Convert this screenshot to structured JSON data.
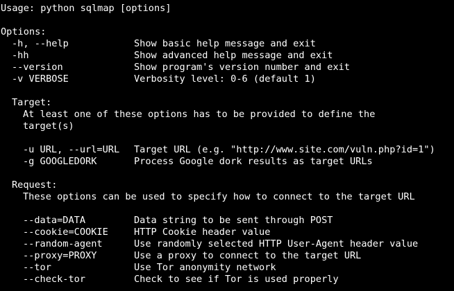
{
  "usage": "Usage: python sqlmap [options]",
  "options_header": "Options:",
  "options": [
    {
      "flag": "-h, --help",
      "desc": "Show basic help message and exit"
    },
    {
      "flag": "-hh",
      "desc": "Show advanced help message and exit"
    },
    {
      "flag": "--version",
      "desc": "Show program's version number and exit"
    },
    {
      "flag": "-v VERBOSE",
      "desc": "Verbosity level: 0-6 (default 1)"
    }
  ],
  "target": {
    "header": "Target:",
    "intro_line1": "At least one of these options has to be provided to define the",
    "intro_line2": "target(s)",
    "options": [
      {
        "flag": "-u URL, --url=URL",
        "desc": "Target URL (e.g. \"http://www.site.com/vuln.php?id=1\")"
      },
      {
        "flag": "-g GOOGLEDORK",
        "desc": "Process Google dork results as target URLs"
      }
    ]
  },
  "request": {
    "header": "Request:",
    "intro_line1": "These options can be used to specify how to connect to the target URL",
    "options": [
      {
        "flag": "--data=DATA",
        "desc": "Data string to be sent through POST"
      },
      {
        "flag": "--cookie=COOKIE",
        "desc": "HTTP Cookie header value"
      },
      {
        "flag": "--random-agent",
        "desc": "Use randomly selected HTTP User-Agent header value"
      },
      {
        "flag": "--proxy=PROXY",
        "desc": "Use a proxy to connect to the target URL"
      },
      {
        "flag": "--tor",
        "desc": "Use Tor anonymity network"
      },
      {
        "flag": "--check-tor",
        "desc": "Check to see if Tor is used properly"
      }
    ]
  },
  "colors": {
    "background": "#000000",
    "foreground": "#ffffff"
  }
}
